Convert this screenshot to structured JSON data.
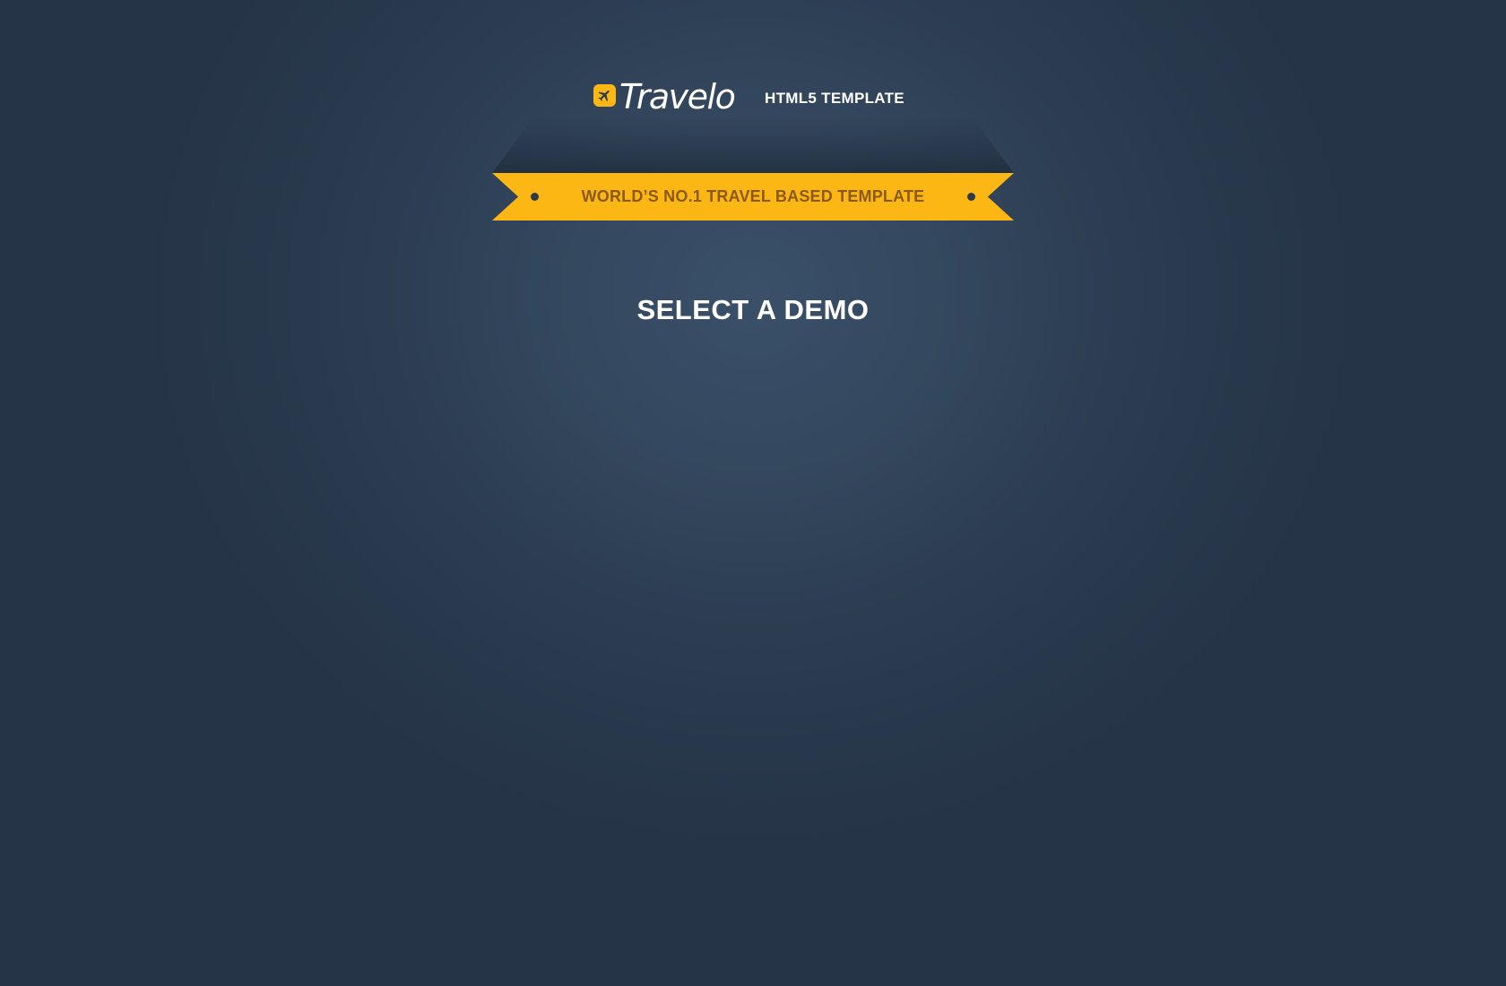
{
  "brand": {
    "logo_text": "Travelo",
    "logo_icon": "airplane-icon",
    "subtitle": "HTML5 TEMPLATE",
    "accent_color": "#fdb714"
  },
  "ribbon": {
    "text": "WORLD’S NO.1 TRAVEL BASED TEMPLATE"
  },
  "main": {
    "title": "SELECT A DEMO"
  },
  "colors": {
    "background": "#253446",
    "background_highlight": "#3a5069",
    "ribbon_text": "#8a5a12"
  }
}
